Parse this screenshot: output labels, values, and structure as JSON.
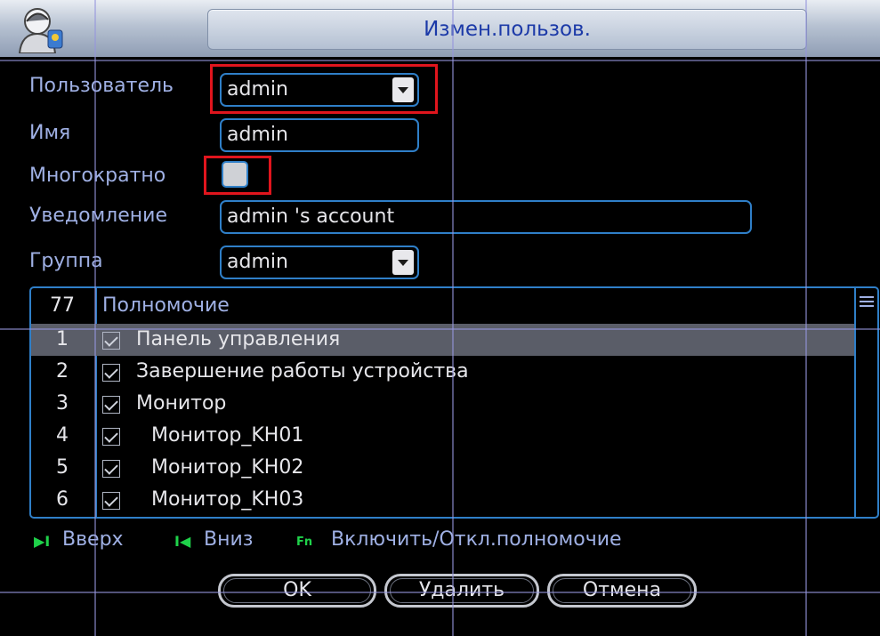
{
  "window": {
    "title": "Измен.пользов."
  },
  "form": {
    "user_label": "Пользователь",
    "user_value": "admin",
    "name_label": "Имя",
    "name_value": "admin",
    "multiple_label": "Многократно",
    "multiple_checked": false,
    "note_label": "Уведомление",
    "note_value": "admin 's account",
    "group_label": "Группа",
    "group_value": "admin"
  },
  "permissions": {
    "count": "77",
    "header": "Полномочие",
    "rows": [
      {
        "num": "1",
        "label": "Панель управления",
        "checked": true,
        "selected": true
      },
      {
        "num": "2",
        "label": "Завершение работы устройства",
        "checked": true
      },
      {
        "num": "3",
        "label": "Монитор",
        "checked": true
      },
      {
        "num": "4",
        "label": "Монитор_KH01",
        "checked": true
      },
      {
        "num": "5",
        "label": "Монитор_KH02",
        "checked": true
      },
      {
        "num": "6",
        "label": "Монитор_KH03",
        "checked": true
      }
    ]
  },
  "hints": {
    "up_icon": "▶I",
    "up_label": "Вверх",
    "down_icon": "I◀",
    "down_label": "Вниз",
    "fn_icon": "Fn",
    "fn_label": "Включить/Откл.полномочие"
  },
  "buttons": {
    "ok": "OK",
    "delete": "Удалить",
    "cancel": "Отмена"
  },
  "colors": {
    "accent": "#2f7fc8",
    "label": "#9fb0e4",
    "highlight": "#e0151d"
  }
}
